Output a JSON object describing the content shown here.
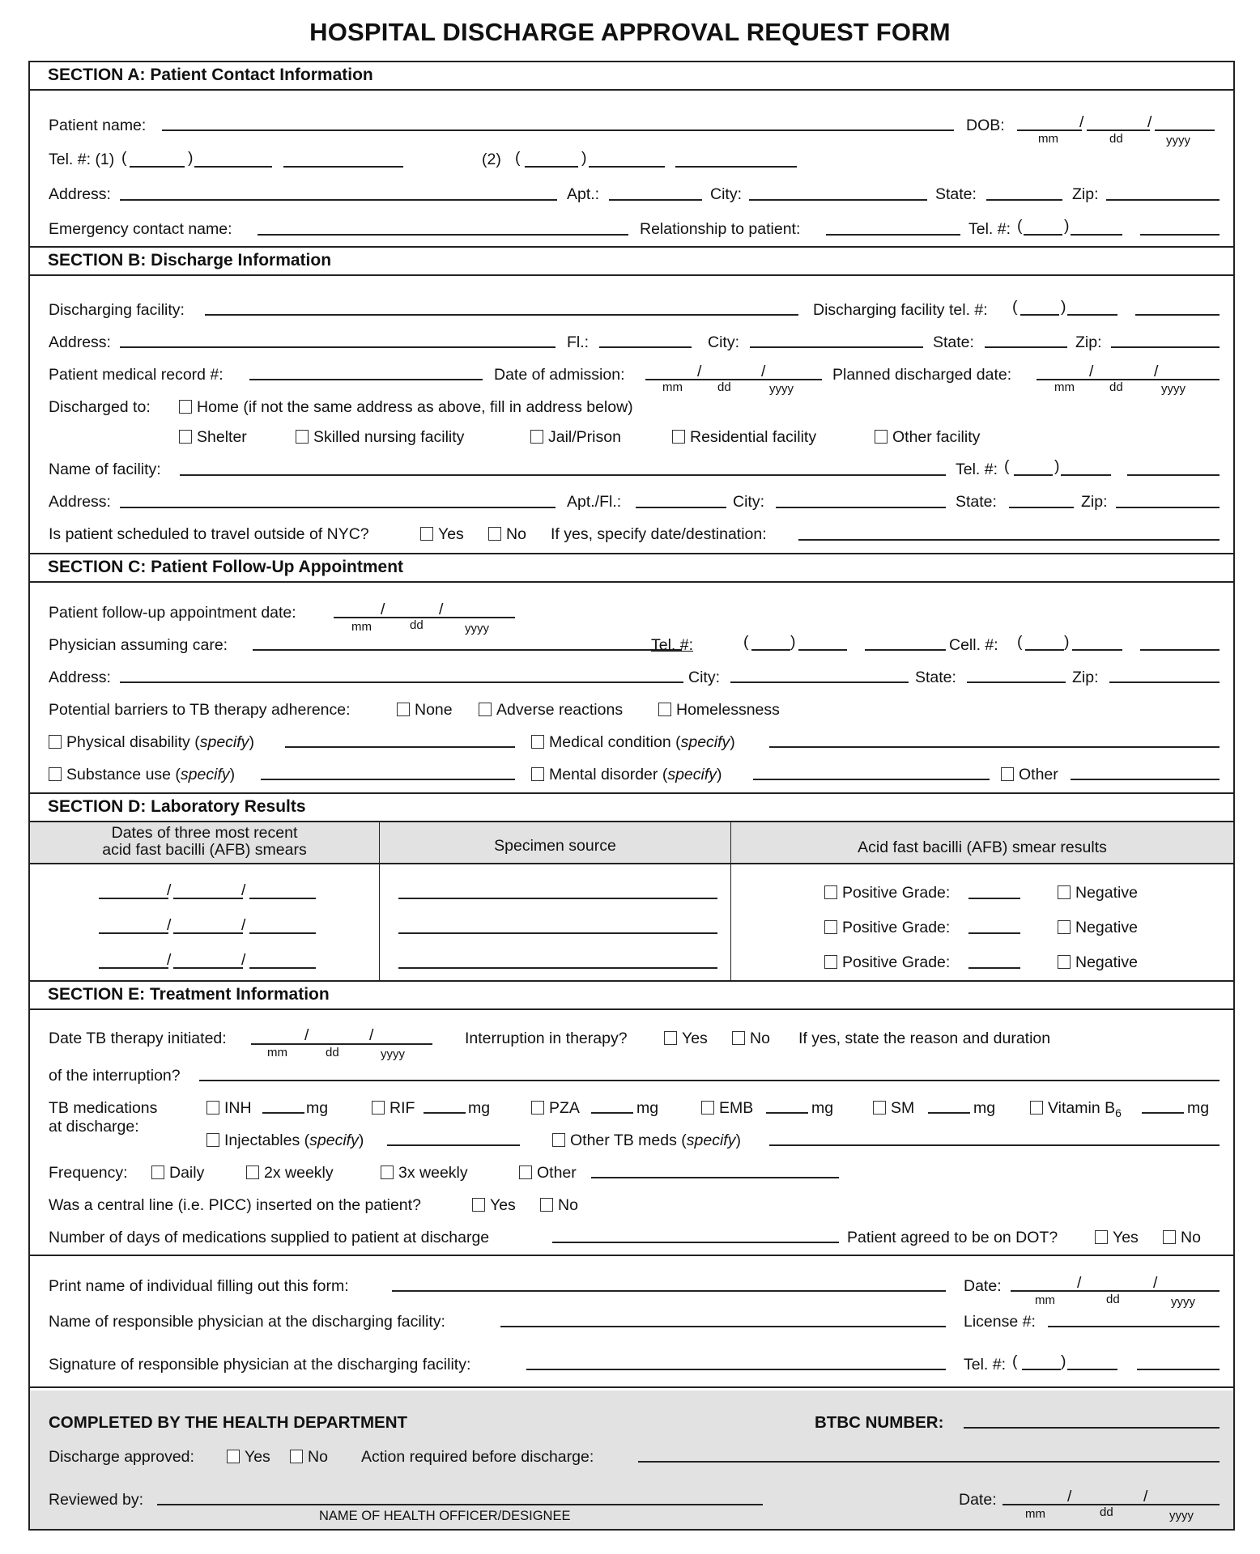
{
  "title": "HOSPITAL DISCHARGE APPROVAL REQUEST FORM",
  "date_sub": {
    "mm": "mm",
    "dd": "dd",
    "yyyy": "yyyy"
  },
  "sectionA": {
    "heading": "SECTION A: Patient Contact Information",
    "patient_name": "Patient name:",
    "dob": "DOB:",
    "tel": "Tel. #: (1)",
    "tel2": "(2)",
    "address": "Address:",
    "apt": "Apt.:",
    "city": "City:",
    "state": "State:",
    "zip": "Zip:",
    "emergency": "Emergency contact name:",
    "relationship": "Relationship to patient:",
    "tel3": "Tel. #:"
  },
  "sectionB": {
    "heading": "SECTION B: Discharge Information",
    "facility": "Discharging facility:",
    "facility_tel": "Discharging facility tel. #:",
    "address": "Address:",
    "fl": "Fl.:",
    "city": "City:",
    "state": "State:",
    "zip": "Zip:",
    "mrn": "Patient medical record #:",
    "admission": "Date of admission:",
    "planned": "Planned discharged date:",
    "discharged_to": "Discharged to:",
    "home": "Home  (if not the same address as above, fill in address below)",
    "options": [
      "Shelter",
      "Skilled nursing facility",
      "Jail/Prison",
      "Residential facility",
      "Other facility"
    ],
    "name_facility": "Name of facility:",
    "tel": "Tel. #:",
    "address2": "Address:",
    "aptfl": "Apt./Fl.:",
    "city2": "City:",
    "state2": "State:",
    "zip2": "Zip:",
    "travel": "Is patient scheduled to travel outside of NYC?",
    "yes": "Yes",
    "no": "No",
    "travel_specify": "If yes, specify date/destination:"
  },
  "sectionC": {
    "heading": "SECTION C: Patient Follow-Up Appointment",
    "appt": "Patient follow-up appointment date:",
    "physician": "Physician assuming care:",
    "tel": "Tel. #:",
    "cell": "Cell. #:",
    "address": "Address:",
    "city": "City:",
    "state": "State:",
    "zip": "Zip:",
    "barriers": "Potential barriers to TB therapy adherence:",
    "none": "None",
    "adverse": "Adverse reactions",
    "homeless": "Homelessness",
    "physical": "Physical disability (",
    "medical": "Medical condition (",
    "substance": "Substance use (",
    "mental": "Mental disorder (",
    "specify": "specify",
    "close": ")",
    "other": "Other"
  },
  "sectionD": {
    "heading": "SECTION D: Laboratory Results",
    "col1_line1": "Dates of three most recent",
    "col1_line2": "acid fast bacilli (AFB) smears",
    "col2": "Specimen source",
    "col3": "Acid fast bacilli (AFB) smear results",
    "positive": "Positive Grade:",
    "negative": "Negative"
  },
  "sectionE": {
    "heading": "SECTION E: Treatment Information",
    "initiated": "Date TB therapy initiated:",
    "interruption": "Interruption in therapy?",
    "yes": "Yes",
    "no": "No",
    "if_yes": "If yes, state the reason and duration",
    "of_interruption": "of the interruption?",
    "meds_line1": "TB medications",
    "meds_line2": "at discharge:",
    "meds": [
      "INH",
      "RIF",
      "PZA",
      "EMB",
      "SM"
    ],
    "vitamin": "Vitamin B",
    "vitamin_sub": "6",
    "mg": "mg",
    "injectables": "Injectables (",
    "other_meds": "Other TB meds (",
    "specify": "specify",
    "close": ")",
    "frequency": "Frequency:",
    "freq_options": [
      "Daily",
      "2x weekly",
      "3x weekly",
      "Other"
    ],
    "picc": "Was a central line (i.e. PICC) inserted on the patient?",
    "days": "Number of days of medications supplied to patient at discharge",
    "dot": "Patient agreed to be on DOT?"
  },
  "signoff": {
    "print_name": "Print name of individual filling out this form:",
    "date": "Date:",
    "physician_name": "Name of responsible physician at the discharging facility:",
    "license": "License #:",
    "signature": "Signature of responsible physician at the discharging facility:",
    "tel": "Tel. #:"
  },
  "health_dept": {
    "heading": "COMPLETED BY THE HEALTH DEPARTMENT",
    "btbc": "BTBC NUMBER:",
    "approved": "Discharge approved:",
    "yes": "Yes",
    "no": "No",
    "action": "Action required before discharge:",
    "reviewed": "Reviewed by:",
    "officer": "NAME OF HEALTH OFFICER/DESIGNEE",
    "date": "Date:"
  }
}
